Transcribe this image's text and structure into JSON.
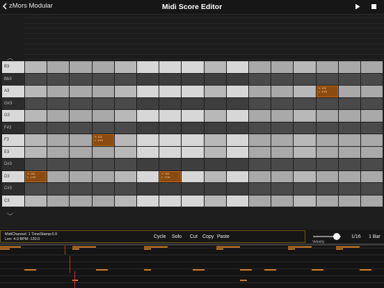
{
  "header": {
    "back_label": "zMors Modular",
    "title": "Midi Score Editor",
    "play_icon": "play-icon",
    "stop_icon": "stop-icon"
  },
  "piano_keys": [
    {
      "label": "B3",
      "black": false
    },
    {
      "label": "Bb3",
      "black": true
    },
    {
      "label": "A3",
      "black": false
    },
    {
      "label": "G#3",
      "black": true
    },
    {
      "label": "G3",
      "black": false
    },
    {
      "label": "F#3",
      "black": true
    },
    {
      "label": "F3",
      "black": false
    },
    {
      "label": "E3",
      "black": false
    },
    {
      "label": "D#3",
      "black": true
    },
    {
      "label": "D3",
      "black": false
    },
    {
      "label": "C#3",
      "black": true
    },
    {
      "label": "C3",
      "black": false
    }
  ],
  "grid": {
    "columns": 16,
    "notes": [
      {
        "row": 2,
        "col": 13,
        "l1": "V: 102",
        "l2": "L: 1/16"
      },
      {
        "row": 6,
        "col": 3,
        "l1": "V: 102",
        "l2": "L: 1/16"
      },
      {
        "row": 9,
        "col": 0,
        "l1": "V: 102",
        "l2": "L: 1/16"
      },
      {
        "row": 9,
        "col": 6,
        "l1": "V: 102",
        "l2": "L: 1/16"
      }
    ]
  },
  "status": {
    "line1": "MidiChannel: 1  TimeStamp:0.0",
    "line2": "Len: 4.0  BPM: 120.0"
  },
  "toolbar": {
    "cycle": "Cycle",
    "solo": "Solo",
    "cut": "Cut",
    "copy": "Copy",
    "paste": "Paste"
  },
  "velocity": {
    "label": "Velocity",
    "value": 0.85
  },
  "quantize": "1/16",
  "length": "1 Bar",
  "colors": {
    "note_fill": "#8b4b10",
    "note_border": "#c06a1a",
    "overview_note": "#d07a22",
    "playhead": "#d42a2a",
    "info_border": "#6a5a16"
  }
}
